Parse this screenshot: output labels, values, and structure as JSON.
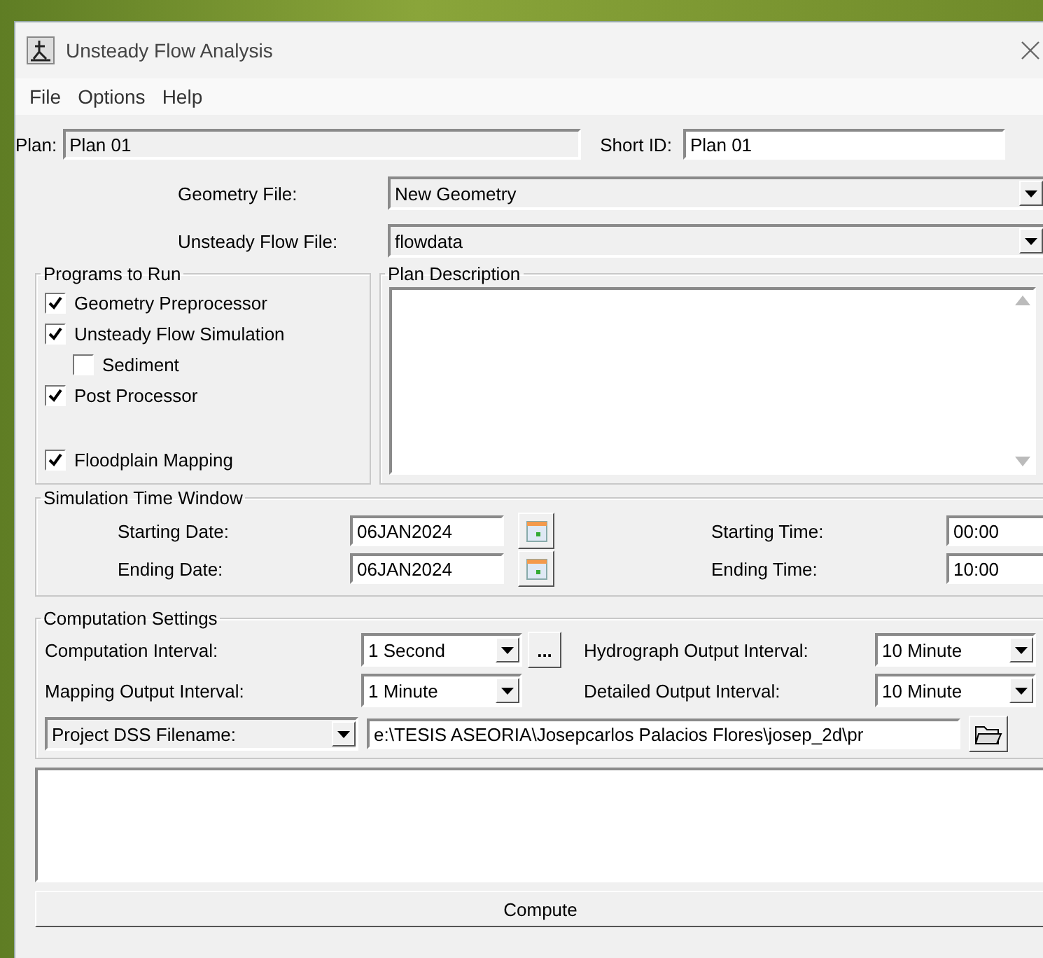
{
  "window": {
    "title": "Unsteady Flow Analysis"
  },
  "menu": [
    "File",
    "Options",
    "Help"
  ],
  "plan": {
    "label": "Plan:",
    "value": "Plan 01",
    "short_id_label": "Short ID:",
    "short_id": "Plan 01"
  },
  "files": [
    {
      "label": "Geometry File:",
      "value": "New Geometry"
    },
    {
      "label": "Unsteady Flow File:",
      "value": "flowdata"
    }
  ],
  "programs": {
    "title": "Programs to Run",
    "items": [
      {
        "label": "Geometry Preprocessor",
        "checked": true
      },
      {
        "label": "Unsteady Flow Simulation",
        "checked": true,
        "children": [
          {
            "label": "Sediment",
            "checked": false
          }
        ]
      },
      {
        "label": "Post Processor",
        "checked": true
      },
      {
        "label": "Floodplain Mapping",
        "checked": true
      }
    ]
  },
  "description": {
    "title": "Plan Description"
  },
  "time_window": {
    "title": "Simulation Time Window",
    "rows": [
      {
        "date_label": "Starting Date:",
        "date": "06JAN2024",
        "time_label": "Starting Time:",
        "time": "00:00"
      },
      {
        "date_label": "Ending Date:",
        "date": "06JAN2024",
        "time_label": "Ending Time:",
        "time": "10:00"
      }
    ]
  },
  "computation": {
    "title": "Computation Settings",
    "settings": [
      {
        "label": "Computation Interval:",
        "value": "1 Second"
      },
      {
        "label": "Hydrograph Output Interval:",
        "value": "10 Minute"
      },
      {
        "label": "Mapping Output Interval:",
        "value": "1 Minute"
      },
      {
        "label": "Detailed Output Interval:",
        "value": "10 Minute"
      }
    ],
    "more_button": "...",
    "dss_type": "Project DSS Filename:",
    "dss_path": "e:\\TESIS ASEORIA\\Josepcarlos Palacios Flores\\josep_2d\\pr"
  },
  "compute_button": "Compute"
}
